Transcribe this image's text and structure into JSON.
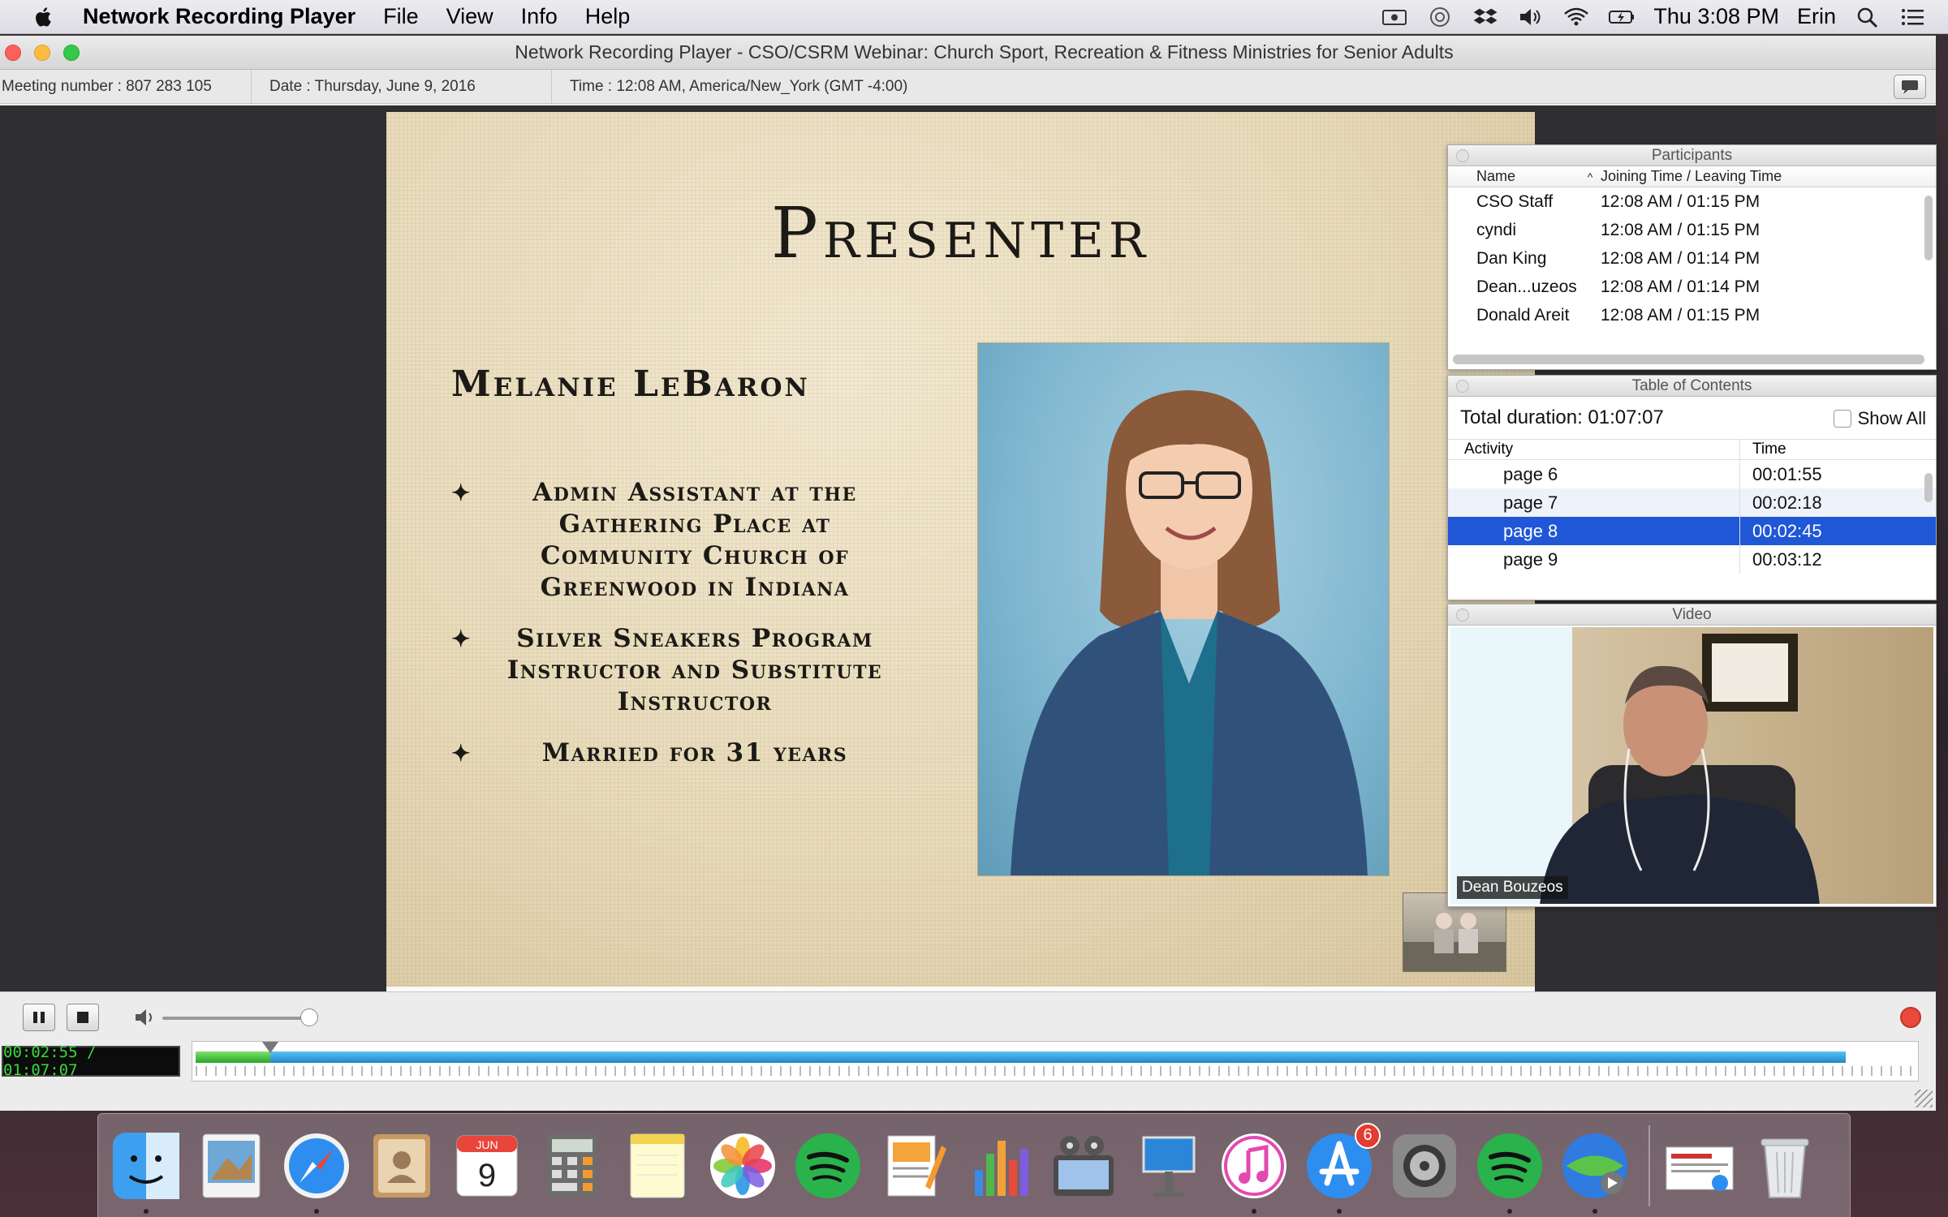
{
  "menubar": {
    "app_name": "Network Recording Player",
    "menus": [
      "File",
      "View",
      "Info",
      "Help"
    ],
    "clock": "Thu 3:08 PM",
    "user": "Erin"
  },
  "window": {
    "title": "Network Recording Player - CSO/CSRM Webinar: Church Sport, Recreation & Fitness Ministries for Senior Adults",
    "meeting_number": "Meeting number : 807 283 105",
    "date": "Date : Thursday, June 9, 2016",
    "time": "Time : 12:08 AM, America/New_York (GMT -4:00)"
  },
  "slide": {
    "title": "Presenter",
    "name": "Melanie LeBaron",
    "bullets": [
      "Admin Assistant at the Gathering Place at Community Church of Greenwood in Indiana",
      "Silver Sneakers Program Instructor and Substitute Instructor",
      "Married for 31 years"
    ],
    "bullet_mark": "✦"
  },
  "participants": {
    "title": "Participants",
    "col_name": "Name",
    "col_time": "Joining Time / Leaving Time",
    "rows": [
      {
        "name": "CSO Staff",
        "time": "12:08 AM / 01:15 PM"
      },
      {
        "name": "cyndi",
        "time": "12:08 AM / 01:15 PM"
      },
      {
        "name": "Dan King",
        "time": "12:08 AM / 01:14 PM"
      },
      {
        "name": "Dean...uzeos",
        "time": "12:08 AM / 01:14 PM"
      },
      {
        "name": "Donald Areit",
        "time": "12:08 AM / 01:15 PM"
      }
    ]
  },
  "toc": {
    "title": "Table of Contents",
    "total_duration": "Total duration: 01:07:07",
    "show_all": "Show All",
    "col_activity": "Activity",
    "col_time": "Time",
    "rows": [
      {
        "activity": "page 6",
        "time": "00:01:55"
      },
      {
        "activity": "page 7",
        "time": "00:02:18"
      },
      {
        "activity": "page 8",
        "time": "00:02:45"
      },
      {
        "activity": "page 9",
        "time": "00:03:12"
      }
    ],
    "selected_index": 2
  },
  "video": {
    "title": "Video",
    "speaker": "Dean Bouzeos"
  },
  "playback": {
    "time_display": "00:02:55 / 01:07:07",
    "elapsed_seconds": 175,
    "total_seconds": 4027,
    "buffered_fraction": 0.96
  },
  "dock": {
    "apps": [
      "finder",
      "preview",
      "safari",
      "contacts",
      "calendar",
      "calculator",
      "notes",
      "photos",
      "spotify",
      "pages",
      "numbers",
      "imovie",
      "keynote",
      "itunes",
      "app-store",
      "system-preferences",
      "spotify",
      "ichat"
    ],
    "calendar_month": "JUN",
    "calendar_day": "9",
    "app_store_badge": "6"
  }
}
